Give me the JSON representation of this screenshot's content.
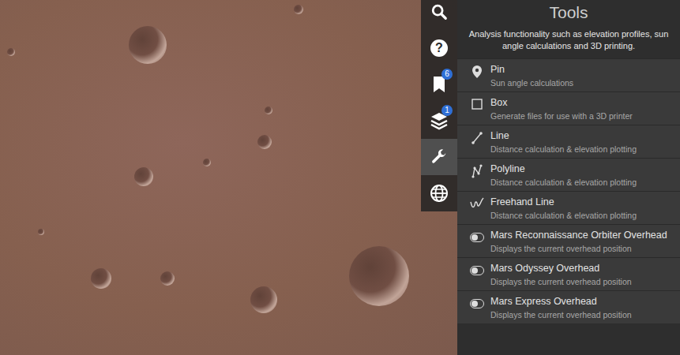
{
  "rail": [
    {
      "kind": "search",
      "selected": false,
      "glyph": "",
      "badge": ""
    },
    {
      "kind": "help",
      "selected": false,
      "glyph": "?",
      "badge": ""
    },
    {
      "kind": "bookmarks",
      "selected": false,
      "glyph": "",
      "badge": "6"
    },
    {
      "kind": "layers",
      "selected": false,
      "glyph": "",
      "badge": "1"
    },
    {
      "kind": "tools",
      "selected": true,
      "glyph": "",
      "badge": ""
    },
    {
      "kind": "globe",
      "selected": false,
      "glyph": "",
      "badge": ""
    }
  ],
  "panel": {
    "title": "Tools",
    "subtitle": "Analysis functionality such as elevation profiles, sun angle calculations and 3D printing."
  },
  "tools": [
    {
      "kind": "pin",
      "label": "Pin",
      "description": "Sun angle calculations"
    },
    {
      "kind": "box",
      "label": "Box",
      "description": "Generate files for use with a 3D printer"
    },
    {
      "kind": "line",
      "label": "Line",
      "description": "Distance calculation & elevation plotting"
    },
    {
      "kind": "polyline",
      "label": "Polyline",
      "description": "Distance calculation & elevation plotting"
    },
    {
      "kind": "freehand",
      "label": "Freehand Line",
      "description": "Distance calculation & elevation plotting"
    }
  ],
  "overhead_toggles": [
    {
      "label": "Mars Reconnaissance Orbiter Overhead",
      "description": "Displays the current overhead position",
      "on": false
    },
    {
      "label": "Mars Odyssey Overhead",
      "description": "Displays the current overhead position",
      "on": false
    },
    {
      "label": "Mars Express Overhead",
      "description": "Displays the current overhead position",
      "on": false
    }
  ]
}
